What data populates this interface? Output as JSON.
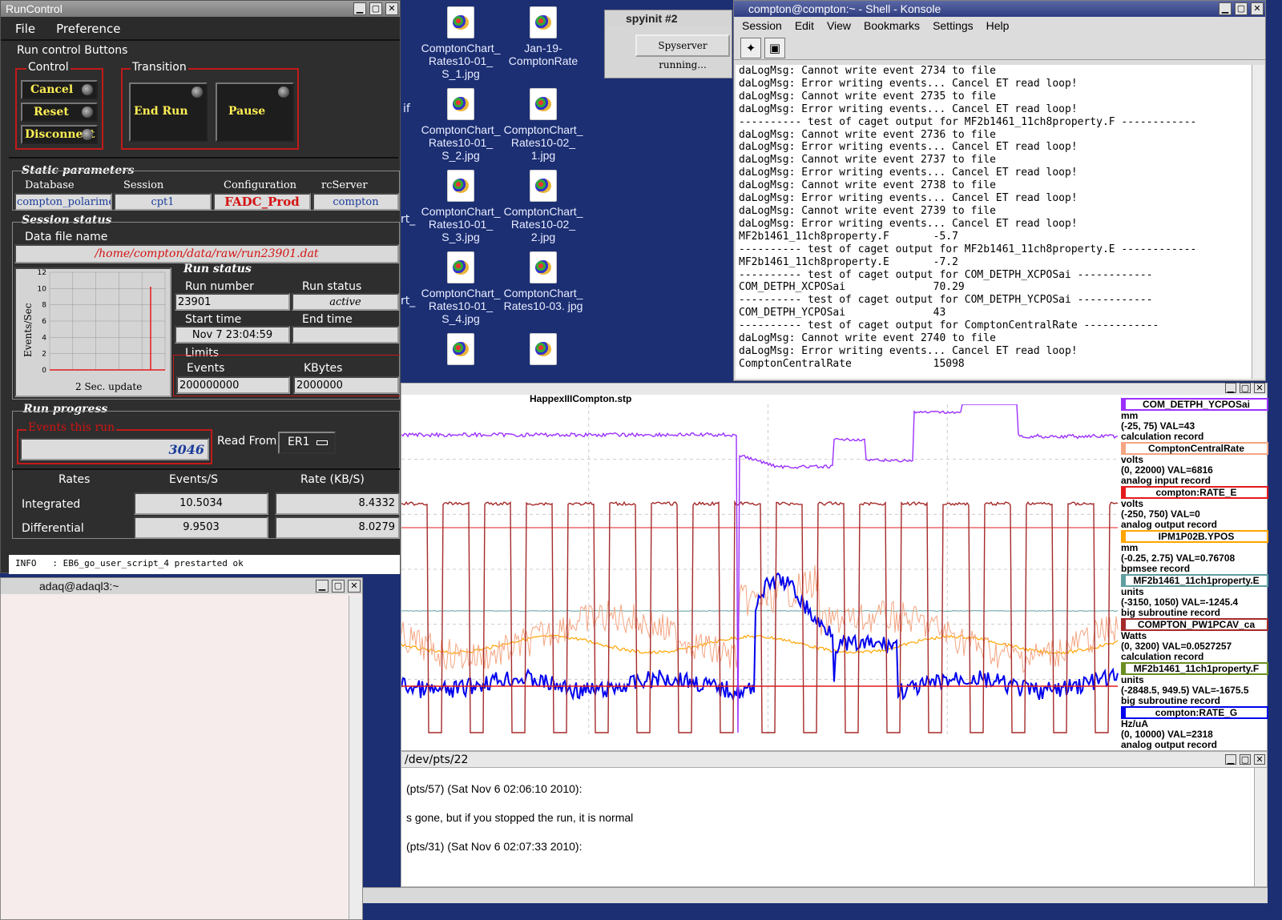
{
  "desktop": {
    "icons": [
      {
        "label": "ComptonChart_ Rates10-01_ S_1.jpg"
      },
      {
        "label": "Jan-19- ComptonRate"
      },
      {
        "label": "ComptonChart_ Rates10-01_ S_2.jpg"
      },
      {
        "label": "ComptonChart_ Rates10-02_ 1.jpg"
      },
      {
        "label": "ComptonChart_ Rates10-01_ S_3.jpg"
      },
      {
        "label": "ComptonChart_ Rates10-02_ 2.jpg"
      },
      {
        "label": "ComptonChart_ Rates10-01_ S_4.jpg"
      },
      {
        "label": "ComptonChart_ Rates10-03. jpg"
      }
    ],
    "partial_text_1": "if",
    "partial_text_2": "rt_",
    "partial_text_3": "rt_"
  },
  "runcontrol": {
    "title": "RunControl",
    "menu": {
      "file": "File",
      "preference": "Preference"
    },
    "run_control_buttons": "Run control Buttons",
    "control": "Control",
    "transition": "Transition",
    "buttons": {
      "cancel": "Cancel",
      "reset": "Reset",
      "disconnect": "Disconnect",
      "end_run": "End Run",
      "pause": "Pause"
    },
    "static_parameters": "Static parameters",
    "static": {
      "database_label": "Database",
      "database": "compton_polarimeter",
      "session_label": "Session",
      "session": "cpt1",
      "configuration_label": "Configuration",
      "configuration": "FADC_Prod",
      "rcserver_label": "rcServer",
      "rcserver": "compton"
    },
    "session_status": "Session status",
    "data_file_label": "Data file name",
    "data_file": "/home/compton/data/raw/run23901.dat",
    "mini_chart": {
      "ylabel": "Events/Sec",
      "yticks": [
        "12",
        "10",
        "8",
        "6",
        "4",
        "2",
        "0"
      ],
      "update": "2 Sec. update"
    },
    "run_status_title": "Run status",
    "run_number_label": "Run number",
    "run_number": "23901",
    "run_status_label": "Run status",
    "run_status": "active",
    "start_time_label": "Start time",
    "start_time": "Nov 7 23:04:59",
    "end_time_label": "End time",
    "end_time": "",
    "limits": "Limits",
    "events_label": "Events",
    "events": "200000000",
    "kbytes_label": "KBytes",
    "kbytes": "2000000",
    "run_progress": "Run progress",
    "events_this_run_label": "Events this run",
    "events_this_run": "3046",
    "read_from_label": "Read From:",
    "read_from": "ER1",
    "rates": {
      "h_rates": "Rates",
      "h_events": "Events/S",
      "h_rate": "Rate (KB/S)",
      "integrated": "Integrated",
      "int_events": "10.5034",
      "int_rate": "8.4332",
      "differential": "Differential",
      "diff_events": "9.9503",
      "diff_rate": "8.0279"
    },
    "info_line": "INFO   : EB6_go_user_script_4 prestarted ok"
  },
  "adaq": {
    "title": "adaq@adaql3:~"
  },
  "spyinit": {
    "title": "spyinit #2",
    "button": "Spyserver running..."
  },
  "konsole": {
    "title": "compton@compton:~ - Shell - Konsole",
    "menu": [
      "Session",
      "Edit",
      "View",
      "Bookmarks",
      "Settings",
      "Help"
    ],
    "lines": [
      "daLogMsg: Cannot write event 2734 to file",
      "daLogMsg: Error writing events... Cancel ET read loop!",
      "daLogMsg: Cannot write event 2735 to file",
      "daLogMsg: Error writing events... Cancel ET read loop!",
      "---------- test of caget output for MF2b1461_11ch8property.F ------------",
      "daLogMsg: Cannot write event 2736 to file",
      "daLogMsg: Error writing events... Cancel ET read loop!",
      "daLogMsg: Cannot write event 2737 to file",
      "daLogMsg: Error writing events... Cancel ET read loop!",
      "daLogMsg: Cannot write event 2738 to file",
      "daLogMsg: Error writing events... Cancel ET read loop!",
      "daLogMsg: Cannot write event 2739 to file",
      "daLogMsg: Error writing events... Cancel ET read loop!",
      "MF2b1461_11ch8property.F       -5.7",
      "---------- test of caget output for MF2b1461_11ch8property.E ------------",
      "MF2b1461_11ch8property.E       -7.2",
      "---------- test of caget output for COM_DETPH_XCPOSai ------------",
      "COM_DETPH_XCPOSai              70.29",
      "---------- test of caget output for COM_DETPH_YCPOSai ------------",
      "COM_DETPH_YCPOSai              43",
      "---------- test of caget output for ComptonCentralRate ------------",
      "daLogMsg: Cannot write event 2740 to file",
      "daLogMsg: Error writing events... Cancel ET read loop!",
      "ComptonCentralRate             15098"
    ]
  },
  "stripchart": {
    "title": "HappexIIICompton.stp",
    "legend": [
      {
        "name": "COM_DETPH_YCPOSai",
        "unit": "mm",
        "range": "(-25, 75) VAL=43",
        "rec": "calculation record",
        "color": "#9b30ff"
      },
      {
        "name": "ComptonCentralRate",
        "unit": "volts",
        "range": "(0, 22000) VAL=6816",
        "rec": "analog input record",
        "color": "#f4a582"
      },
      {
        "name": "compton:RATE_E",
        "unit": "volts",
        "range": "(-250, 750) VAL=0",
        "rec": "analog output record",
        "color": "#e41a1c"
      },
      {
        "name": "IPM1P02B.YPOS",
        "unit": "mm",
        "range": "(-0.25, 2.75) VAL=0.76708",
        "rec": "bpmsee record",
        "color": "#ffa500"
      },
      {
        "name": "MF2b1461_11ch1property.E",
        "unit": "units",
        "range": "(-3150, 1050) VAL=-1245.4",
        "rec": "big subroutine record",
        "color": "#5f9ea0"
      },
      {
        "name": "COMPTON_PW1PCAV_ca",
        "unit": "Watts",
        "range": "(0, 3200) VAL=0.0527257",
        "rec": "calculation record",
        "color": "#a52a2a"
      },
      {
        "name": "MF2b1461_11ch1property.F",
        "unit": "units",
        "range": "(-2848.5, 949.5) VAL=-1675.5",
        "rec": "big subroutine record",
        "color": "#6b8e23"
      },
      {
        "name": "compton:RATE_G",
        "unit": "Hz/uA",
        "range": "(0, 10000) VAL=2318",
        "rec": "analog output record",
        "color": "#0000ee"
      }
    ]
  },
  "pts": {
    "title": "/dev/pts/22",
    "line1": "(pts/57) (Sat Nov  6 02:06:10 2010):",
    "line2": "s gone, but if you stopped the run, it is normal",
    "line3": "(pts/31) (Sat Nov  6 02:07:33 2010):"
  }
}
